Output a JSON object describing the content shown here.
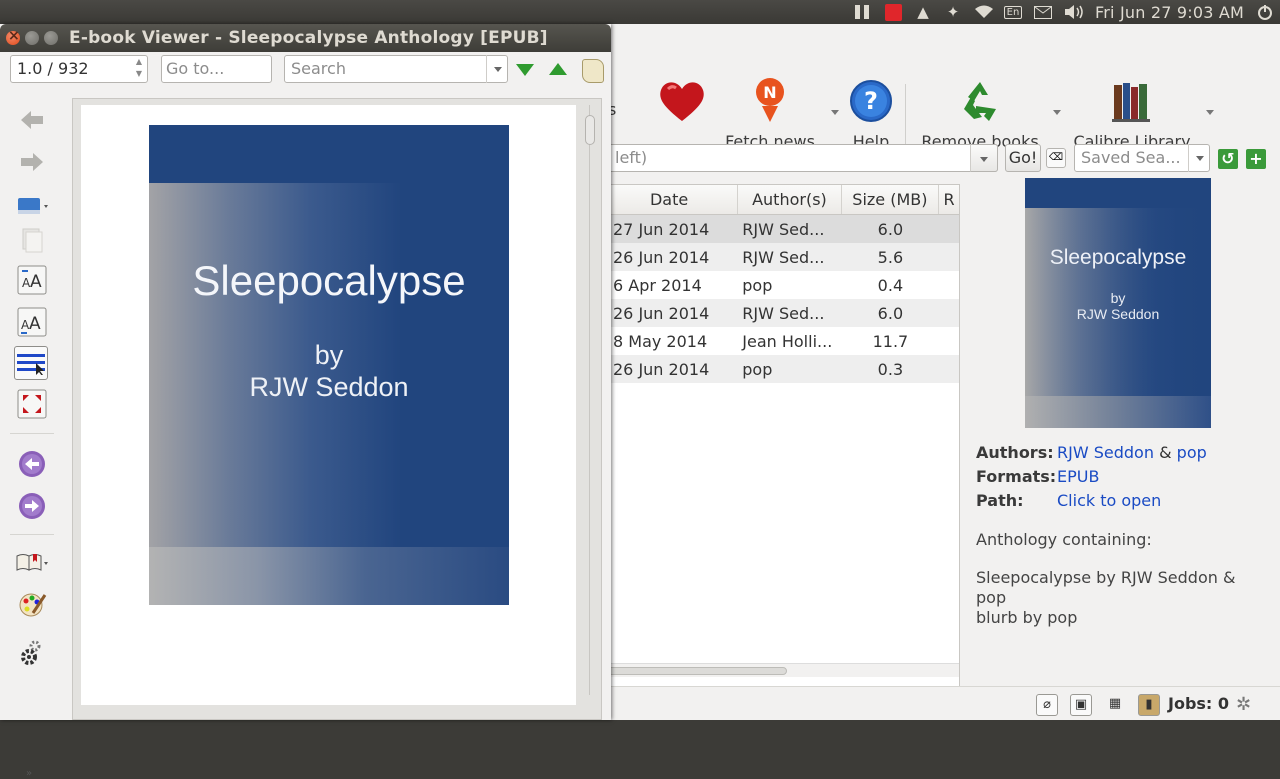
{
  "panel": {
    "clock": "Fri Jun 27  9:03 AM",
    "keyboard": "En"
  },
  "calibre": {
    "toolbar": {
      "partial_left": "s",
      "fetch_news": "Fetch news",
      "help": "Help",
      "remove_books": "Remove books",
      "calibre_library": "Calibre Library"
    },
    "search": {
      "value": "left)",
      "go": "Go!",
      "saved_placeholder": "Saved Sea..."
    },
    "table": {
      "headers": [
        "Date",
        "Author(s)",
        "Size (MB)",
        "R"
      ],
      "rows": [
        {
          "date": "27 Jun 2014",
          "author": "RJW Sed...",
          "size": "6.0"
        },
        {
          "date": "26 Jun 2014",
          "author": "RJW Sed...",
          "size": "5.6"
        },
        {
          "date": "6 Apr 2014",
          "author": "pop",
          "size": "0.4"
        },
        {
          "date": "26 Jun 2014",
          "author": "RJW Sed...",
          "size": "6.0"
        },
        {
          "date": "8 May 2014",
          "author": "Jean Holli...",
          "size": "11.7"
        },
        {
          "date": "26 Jun 2014",
          "author": "pop",
          "size": "0.3"
        }
      ]
    },
    "cover": {
      "title": "Sleepocalypse",
      "by": "by",
      "author": "RJW Seddon"
    },
    "details": {
      "authors_label": "Authors:",
      "author1": "RJW Seddon",
      "amp": "&",
      "author2": "pop",
      "formats_label": "Formats:",
      "format": "EPUB",
      "path_label": "Path:",
      "path_link": "Click to open",
      "comment1": "Anthology containing:",
      "comment2": "Sleepocalypse by RJW Seddon & pop",
      "comment3": "blurb by pop"
    },
    "status": {
      "jobs": "Jobs: 0"
    }
  },
  "viewer": {
    "title": "E-book Viewer - Sleepocalypse Anthology [EPUB]",
    "page_value": "1.0 / 932",
    "goto_placeholder": "Go to...",
    "search_placeholder": "Search",
    "cover": {
      "title": "Sleepocalypse",
      "by": "by",
      "author": "RJW Seddon"
    }
  }
}
